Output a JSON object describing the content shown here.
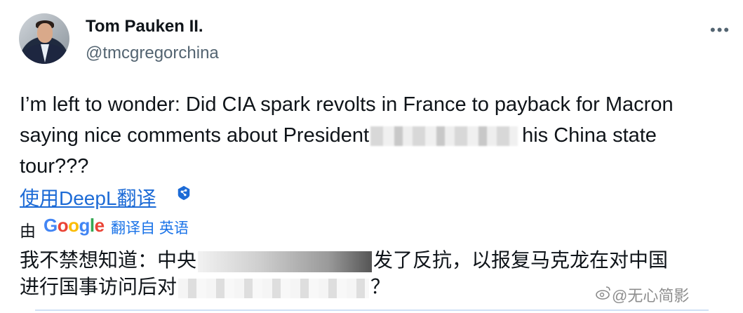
{
  "tweet": {
    "author_name": "Tom Pauken II.",
    "author_handle": "@tmcgregorchina",
    "more_label": "•••",
    "text_line1": "I’m left to wonder: Did CIA spark revolts in France to payback for Macron",
    "text_line2a": "saying nice comments about President",
    "text_line2b": "his China state",
    "text_line3": "tour???"
  },
  "translation": {
    "deepl_link": "使用DeepL翻译",
    "by_label": "由",
    "google_letters": [
      "G",
      "o",
      "o",
      "g",
      "l",
      "e"
    ],
    "from_lang_label": "翻译自 英语",
    "line1a": "我不禁想知道：中央",
    "line1b": "发了反抗，以报复马克龙在对中国",
    "line2a": "进行国事访问后对",
    "line2b": "？"
  },
  "watermark": {
    "text": "@无心简影"
  },
  "colors": {
    "link": "#1d6bd6",
    "handle": "#536471",
    "google_blue": "#4285f4"
  }
}
